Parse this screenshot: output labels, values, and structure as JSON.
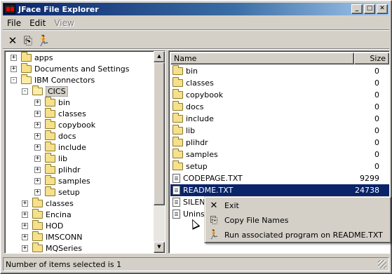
{
  "window": {
    "title": "JFace File Explorer",
    "buttons": {
      "minimize": "_",
      "maximize": "□",
      "close": "✕"
    }
  },
  "menubar": {
    "items": [
      {
        "label": "File",
        "enabled": true
      },
      {
        "label": "Edit",
        "enabled": true
      },
      {
        "label": "View",
        "enabled": false
      }
    ]
  },
  "toolbar": {
    "items": [
      {
        "icon": "close-icon",
        "glyph": "✕"
      },
      {
        "icon": "copy-icon",
        "glyph": "⎘"
      },
      {
        "icon": "run-icon",
        "glyph": "🏃"
      }
    ]
  },
  "tree": {
    "nodes": [
      {
        "label": "apps",
        "level": 0,
        "expander": "+"
      },
      {
        "label": "Documents and Settings",
        "level": 0,
        "expander": "+"
      },
      {
        "label": "IBM Connectors",
        "level": 0,
        "expander": "-"
      },
      {
        "label": "CICS",
        "level": 1,
        "expander": "-",
        "selected": true
      },
      {
        "label": "bin",
        "level": 2,
        "expander": "+"
      },
      {
        "label": "classes",
        "level": 2,
        "expander": "+"
      },
      {
        "label": "copybook",
        "level": 2,
        "expander": "+"
      },
      {
        "label": "docs",
        "level": 2,
        "expander": "+"
      },
      {
        "label": "include",
        "level": 2,
        "expander": "+"
      },
      {
        "label": "lib",
        "level": 2,
        "expander": "+"
      },
      {
        "label": "plihdr",
        "level": 2,
        "expander": "+"
      },
      {
        "label": "samples",
        "level": 2,
        "expander": "+"
      },
      {
        "label": "setup",
        "level": 2,
        "expander": "+"
      },
      {
        "label": "classes",
        "level": 1,
        "expander": "+"
      },
      {
        "label": "Encina",
        "level": 1,
        "expander": "+"
      },
      {
        "label": "HOD",
        "level": 1,
        "expander": "+"
      },
      {
        "label": "IMSCONN",
        "level": 1,
        "expander": "+"
      },
      {
        "label": "MQSeries",
        "level": 1,
        "expander": "+"
      }
    ]
  },
  "table": {
    "headers": {
      "name": "Name",
      "size": "Size"
    },
    "rows": [
      {
        "name": "bin",
        "size": "0",
        "type": "folder"
      },
      {
        "name": "classes",
        "size": "0",
        "type": "folder"
      },
      {
        "name": "copybook",
        "size": "0",
        "type": "folder"
      },
      {
        "name": "docs",
        "size": "0",
        "type": "folder"
      },
      {
        "name": "include",
        "size": "0",
        "type": "folder"
      },
      {
        "name": "lib",
        "size": "0",
        "type": "folder"
      },
      {
        "name": "plihdr",
        "size": "0",
        "type": "folder"
      },
      {
        "name": "samples",
        "size": "0",
        "type": "folder"
      },
      {
        "name": "setup",
        "size": "0",
        "type": "folder"
      },
      {
        "name": "CODEPAGE.TXT",
        "size": "9299",
        "type": "file"
      },
      {
        "name": "README.TXT",
        "size": "24738",
        "type": "file",
        "selected": true
      },
      {
        "name": "SILENT",
        "size": "",
        "type": "file"
      },
      {
        "name": "Uninst",
        "size": "",
        "type": "file"
      }
    ]
  },
  "context_menu": {
    "items": [
      {
        "label": "Exit",
        "icon": "close-icon",
        "glyph": "✕"
      },
      {
        "label": "Copy File Names",
        "icon": "copy-icon",
        "glyph": "⎘"
      },
      {
        "label": "Run associated program on README.TXT",
        "icon": "run-icon",
        "glyph": "🏃"
      }
    ]
  },
  "status": {
    "text": "Number of items selected is 1"
  },
  "colors": {
    "title_gradient_start": "#0a246a",
    "selection": "#0a246a",
    "chrome": "#d4d0c8"
  }
}
